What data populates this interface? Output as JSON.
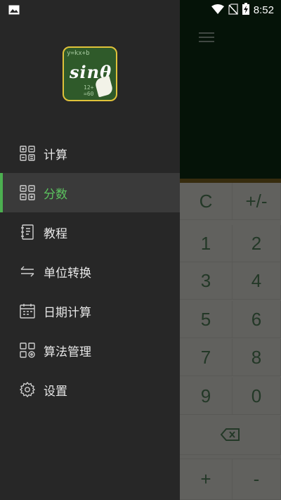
{
  "status_bar": {
    "time": "8:52",
    "left_icon": "image-icon",
    "right_icons": [
      "wifi-icon",
      "no-sim-icon",
      "battery-charging-icon"
    ]
  },
  "drawer": {
    "logo": {
      "text": "sinθ",
      "scribble_top": "y=kx+b",
      "scribble_bottom": "12+ =60"
    },
    "items": [
      {
        "label": "计算",
        "icon": "calculator-grid-icon",
        "active": false
      },
      {
        "label": "分数",
        "icon": "fraction-grid-icon",
        "active": true
      },
      {
        "label": "教程",
        "icon": "notebook-icon",
        "active": false
      },
      {
        "label": "单位转换",
        "icon": "swap-arrows-icon",
        "active": false
      },
      {
        "label": "日期计算",
        "icon": "calendar-icon",
        "active": false
      },
      {
        "label": "算法管理",
        "icon": "algorithm-manage-icon",
        "active": false
      },
      {
        "label": "设置",
        "icon": "settings-gear-icon",
        "active": false
      }
    ],
    "accent_color": "#4caf50"
  },
  "calculator": {
    "menu_icon": "hamburger-menu-icon",
    "keys": {
      "clear": "C",
      "plus_minus": "+/-",
      "k1": "1",
      "k2": "2",
      "k3": "3",
      "k4": "4",
      "k5": "5",
      "k6": "6",
      "k7": "7",
      "k8": "8",
      "k9": "9",
      "k0": "0",
      "plus": "+",
      "minus": "-"
    },
    "backspace_icon": "backspace-icon"
  }
}
